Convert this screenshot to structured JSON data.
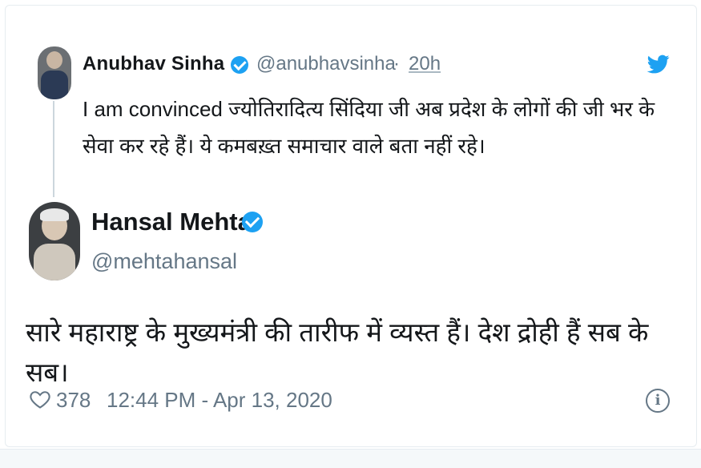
{
  "reply": {
    "author_name": "Anubhav Sinha",
    "handle": "@anubhavsinha",
    "separator": "·",
    "time": "20h",
    "text": "I am convinced ज्योतिरादित्य सिंदिया जी अब प्रदेश के लोगों की जी भर के सेवा कर रहे हैं। ये कमबख़्त समाचार वाले बता नहीं रहे।"
  },
  "tweet": {
    "author_name": "Hansal Mehta",
    "handle": "@mehtahansal",
    "text": "सारे महाराष्ट्र के मुख्यमंत्री की तारीफ में व्यस्त हैं। देश द्रोही हैं सब के सब।",
    "likes": "378",
    "timestamp": "12:44 PM - Apr 13, 2020",
    "info_symbol": "i"
  },
  "icons": {
    "verified": "verified-badge-icon",
    "brand": "twitter-bird-icon",
    "like": "heart-icon",
    "info": "info-icon"
  },
  "colors": {
    "accent": "#1da1f2",
    "secondary_text": "#657786",
    "primary_text": "#14171a"
  }
}
